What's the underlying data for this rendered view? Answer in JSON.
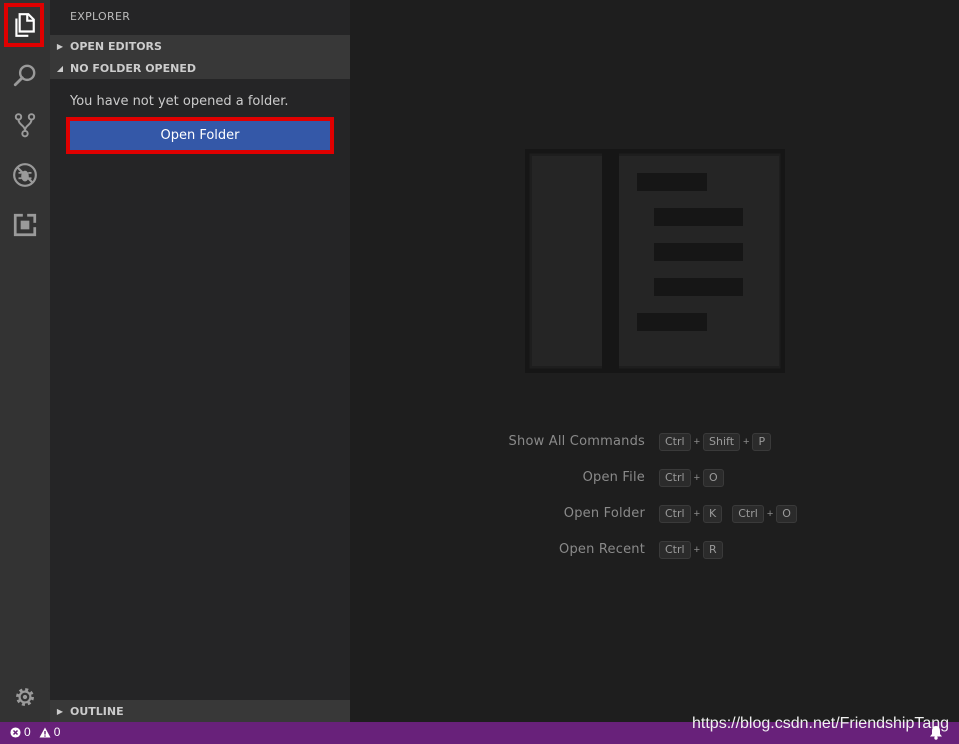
{
  "sidebar": {
    "title": "EXPLORER",
    "sections": {
      "open_editors": "OPEN EDITORS",
      "no_folder": "NO FOLDER OPENED",
      "outline": "OUTLINE"
    },
    "empty_message": "You have not yet opened a folder.",
    "open_folder_label": "Open Folder"
  },
  "shortcuts": [
    {
      "label": "Show All Commands",
      "keys": [
        [
          "Ctrl",
          "Shift",
          "P"
        ]
      ]
    },
    {
      "label": "Open File",
      "keys": [
        [
          "Ctrl",
          "O"
        ]
      ]
    },
    {
      "label": "Open Folder",
      "keys": [
        [
          "Ctrl",
          "K"
        ],
        [
          "Ctrl",
          "O"
        ]
      ]
    },
    {
      "label": "Open Recent",
      "keys": [
        [
          "Ctrl",
          "R"
        ]
      ]
    }
  ],
  "statusbar": {
    "errors": "0",
    "warnings": "0",
    "watermark": "https://blog.csdn.net/FriendshipTang"
  },
  "colors": {
    "accent": "#3458a8",
    "statusbar": "#68217a",
    "highlight": "#e00000"
  }
}
